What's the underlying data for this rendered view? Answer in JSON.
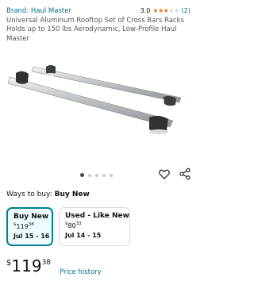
{
  "product": {
    "brand": "Brand: Haul Master",
    "rating_value": "3.0",
    "rating_stars": 3,
    "rating_count": "(2)",
    "title": "Universal Aluminum Rooftop Set of Cross Bars Racks Holds up to 150 lbs Aerodynamic, Low-Profile Haul Master"
  },
  "gallery": {
    "image_count": 5,
    "active_index": 0
  },
  "buying": {
    "ways_label": "Ways to buy:",
    "ways_selected": "Buy New",
    "options": [
      {
        "label": "Buy New",
        "currency": "$",
        "whole": "119",
        "fraction": "38",
        "date": "Jul 15 - 16"
      },
      {
        "label": "Used - Like New",
        "currency": "$",
        "whole": "80",
        "fraction": "33",
        "date": "Jul 14 - 15"
      }
    ]
  },
  "price": {
    "currency": "$",
    "whole": "119",
    "fraction": "38",
    "history_label": "Price history"
  },
  "colors": {
    "link": "#007185",
    "star": "#de7921",
    "selected_border": "#008296"
  },
  "icons": {
    "wishlist": "heart-icon",
    "share": "share-icon"
  }
}
